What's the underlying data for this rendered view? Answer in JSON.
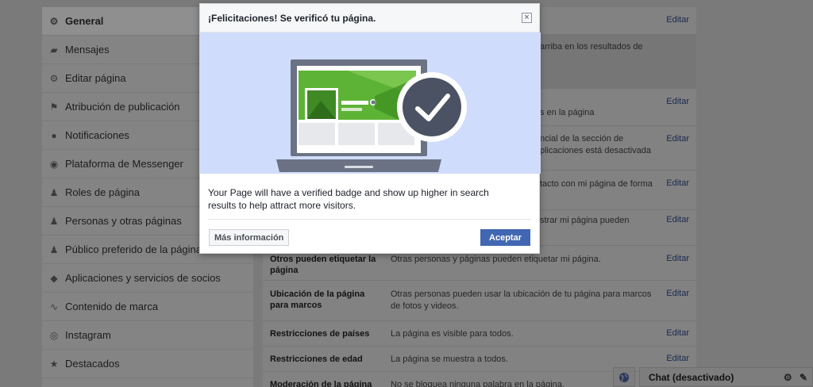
{
  "sidebar": {
    "items": [
      {
        "label": "General",
        "icon": "gear-icon"
      },
      {
        "label": "Mensajes",
        "icon": "messages-icon"
      },
      {
        "label": "Editar página",
        "icon": "gear-icon"
      },
      {
        "label": "Atribución de publicación",
        "icon": "flag-icon"
      },
      {
        "label": "Notificaciones",
        "icon": "globe-icon"
      },
      {
        "label": "Plataforma de Messenger",
        "icon": "messenger-icon"
      },
      {
        "label": "Roles de página",
        "icon": "person-icon"
      },
      {
        "label": "Personas y otras páginas",
        "icon": "person-star-icon"
      },
      {
        "label": "Público preferido de la página",
        "icon": "person-star-icon"
      },
      {
        "label": "Aplicaciones y servicios de socios",
        "icon": "cube-icon"
      },
      {
        "label": "Contenido de marca",
        "icon": "handshake-icon"
      },
      {
        "label": "Instagram",
        "icon": "instagram-icon"
      },
      {
        "label": "Destacados",
        "icon": "star-icon"
      }
    ]
  },
  "main": {
    "edit_label": "Editar",
    "partial_texts": {
      "r0": "arriba en los resultados de",
      "r1": "s en la página",
      "r2a": "ncial de la sección de",
      "r2b": "plicaciones está desactivada",
      "r3": "tacto con mi página de forma",
      "r4a": "strar mi página pueden"
    },
    "rows": [
      {
        "label": "Otros pueden etiquetar la página",
        "desc": "Otras personas y páginas pueden etiquetar mi página."
      },
      {
        "label": "Ubicación de la página para marcos",
        "desc": "Otras personas pueden usar la ubicación de tu página para marcos de fotos y videos."
      },
      {
        "label": "Restricciones de países",
        "desc": "La página es visible para todos."
      },
      {
        "label": "Restricciones de edad",
        "desc": "La página se muestra a todos."
      },
      {
        "label": "Moderación de la página",
        "desc": "No se bloquea ninguna palabra en la página."
      }
    ]
  },
  "chat": {
    "label": "Chat (desactivado)"
  },
  "modal": {
    "title": "¡Felicitaciones! Se verificó tu página.",
    "close": "×",
    "body": "Your Page will have a verified badge and show up higher in search results to help attract more visitors.",
    "more_button": "Más información",
    "accept_button": "Aceptar"
  },
  "colors": {
    "accent": "#4267b2",
    "illustration_bg": "#cfdcfb",
    "green": "#5db336"
  }
}
